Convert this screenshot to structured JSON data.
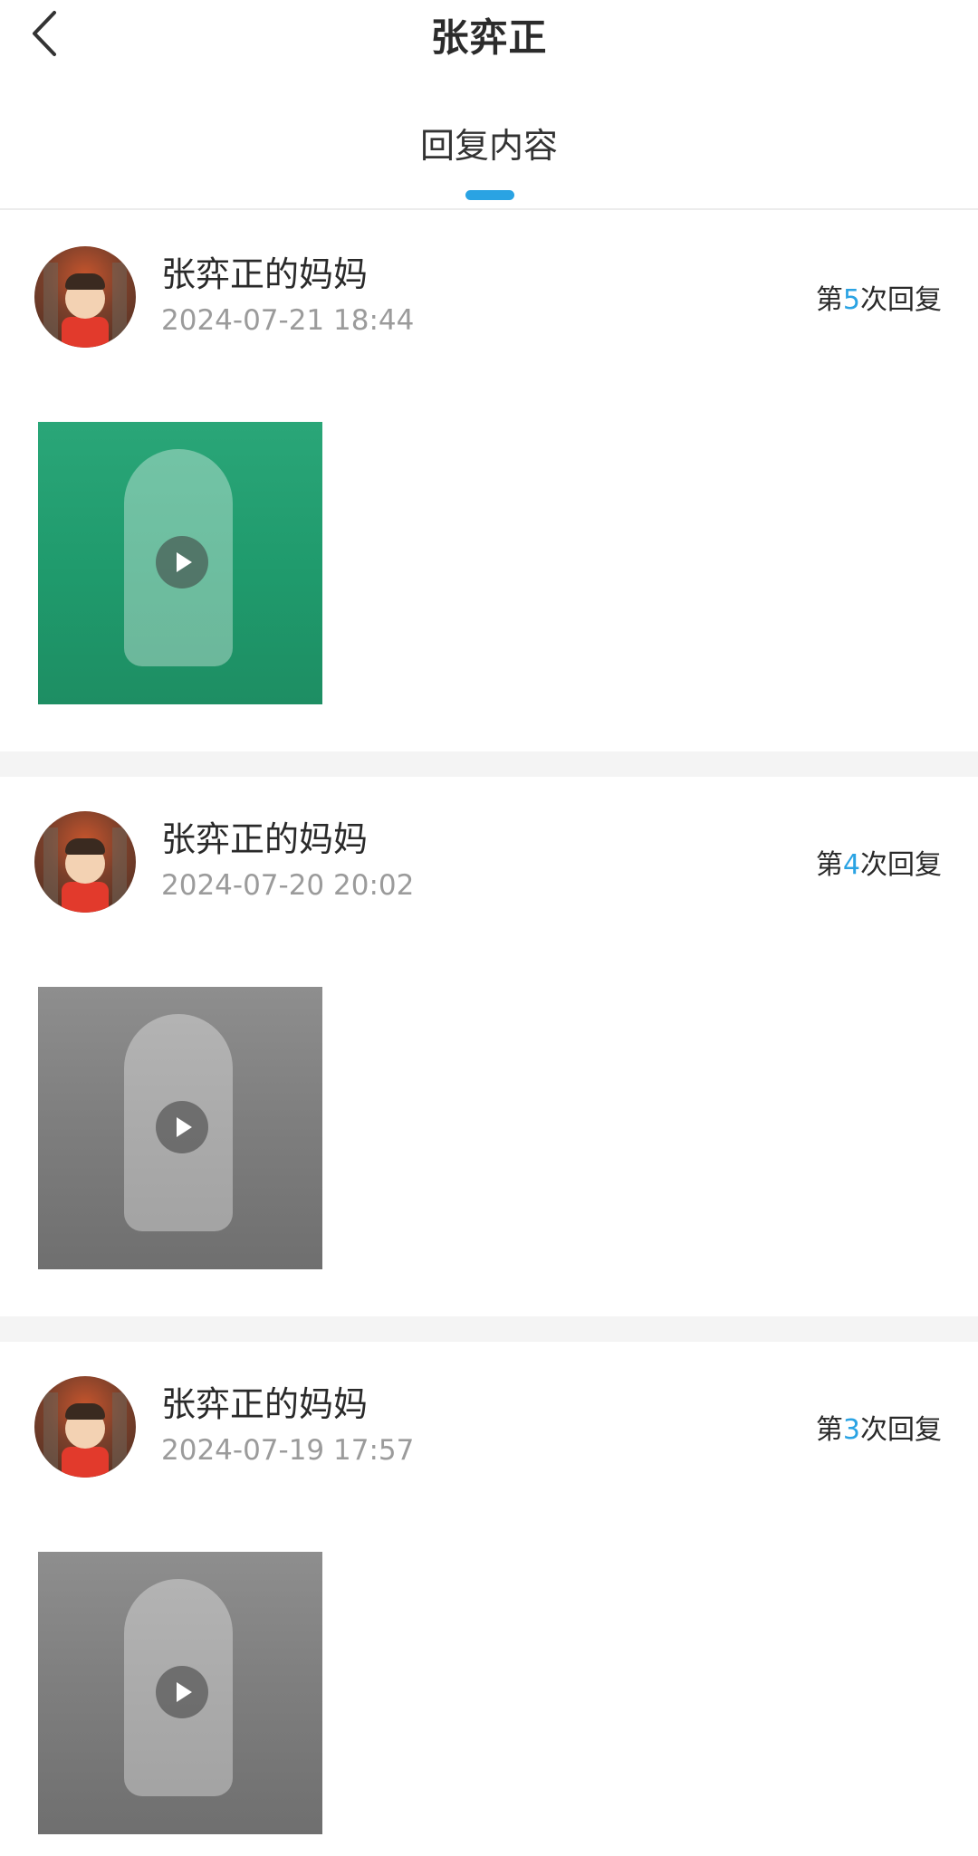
{
  "header": {
    "title": "张弈正",
    "back_icon": "chevron-left-icon"
  },
  "tabs": [
    {
      "label": "回复内容",
      "active": true
    }
  ],
  "colors": {
    "accent": "#2aa3e3",
    "separator": "#f4f4f4"
  },
  "replies": [
    {
      "user_name": "张弈正的妈妈",
      "time": "2024-07-21 18:44",
      "count_prefix": "第",
      "count_number": "5",
      "count_suffix": "次回复",
      "media_type": "video"
    },
    {
      "user_name": "张弈正的妈妈",
      "time": "2024-07-20 20:02",
      "count_prefix": "第",
      "count_number": "4",
      "count_suffix": "次回复",
      "media_type": "video"
    },
    {
      "user_name": "张弈正的妈妈",
      "time": "2024-07-19 17:57",
      "count_prefix": "第",
      "count_number": "3",
      "count_suffix": "次回复",
      "media_type": "video"
    }
  ]
}
